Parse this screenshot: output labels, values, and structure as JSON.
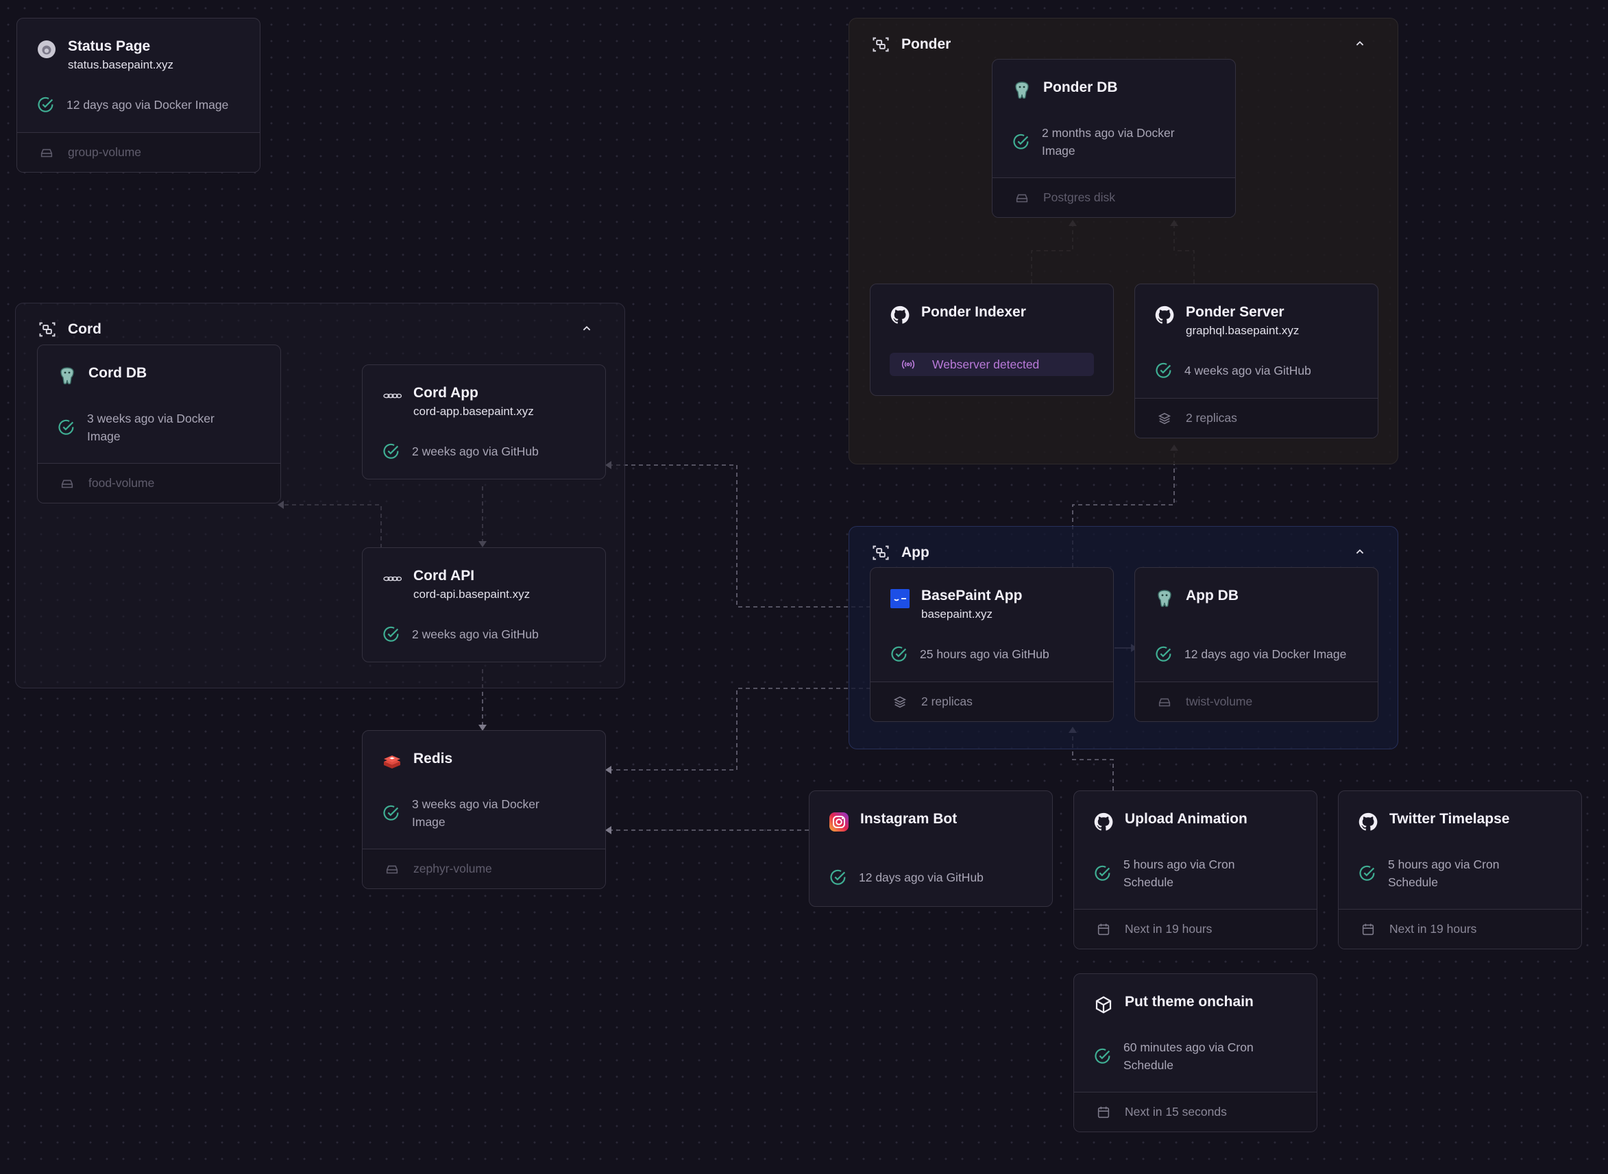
{
  "groups": {
    "ponder": {
      "label": "Ponder"
    },
    "cord": {
      "label": "Cord"
    },
    "app": {
      "label": "App"
    }
  },
  "services": {
    "status_page": {
      "title": "Status Page",
      "domain": "status.basepaint.xyz",
      "status": "12 days ago via Docker Image",
      "footer": "group-volume"
    },
    "ponder_db": {
      "title": "Ponder DB",
      "status": "2 months ago via Docker Image",
      "footer": "Postgres disk"
    },
    "ponder_indexer": {
      "title": "Ponder Indexer",
      "badge": "Webserver detected"
    },
    "ponder_server": {
      "title": "Ponder Server",
      "domain": "graphql.basepaint.xyz",
      "status": "4 weeks ago via GitHub",
      "footer": "2 replicas"
    },
    "cord_db": {
      "title": "Cord DB",
      "status": "3 weeks ago via Docker Image",
      "footer": "food-volume"
    },
    "cord_app": {
      "title": "Cord App",
      "domain": "cord-app.basepaint.xyz",
      "status": "2 weeks ago via GitHub"
    },
    "cord_api": {
      "title": "Cord API",
      "domain": "cord-api.basepaint.xyz",
      "status": "2 weeks ago via GitHub"
    },
    "basepaint_app": {
      "title": "BasePaint App",
      "domain": "basepaint.xyz",
      "status": "25 hours ago via GitHub",
      "footer": "2 replicas"
    },
    "app_db": {
      "title": "App DB",
      "status": "12 days ago via Docker Image",
      "footer": "twist-volume"
    },
    "redis": {
      "title": "Redis",
      "status": "3 weeks ago via Docker Image",
      "footer": "zephyr-volume"
    },
    "instagram_bot": {
      "title": "Instagram Bot",
      "status": "12 days ago via GitHub"
    },
    "upload_animation": {
      "title": "Upload Animation",
      "status": "5 hours ago via Cron Schedule",
      "footer": "Next in 19 hours"
    },
    "twitter_timelapse": {
      "title": "Twitter Timelapse",
      "status": "5 hours ago via Cron Schedule",
      "footer": "Next in 19 hours"
    },
    "put_theme": {
      "title": "Put theme onchain",
      "status": "60 minutes ago via Cron Schedule",
      "footer": "Next in 15 seconds"
    }
  },
  "colors": {
    "background": "#13111c",
    "success": "#3fae93",
    "badge_text": "#b97ad9",
    "app_group_border": "#27305a"
  }
}
